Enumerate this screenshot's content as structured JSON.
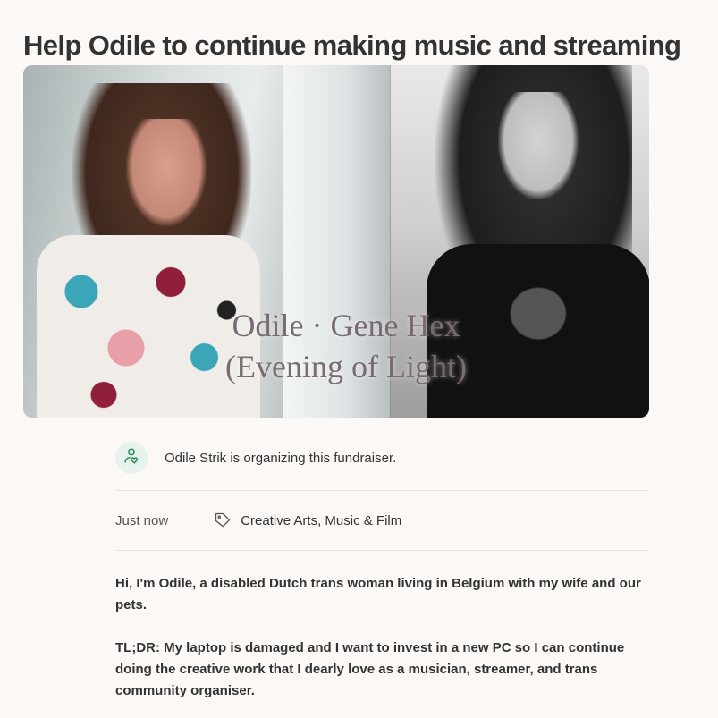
{
  "title": "Help Odile to continue making music and streaming",
  "hero": {
    "caption_line1": "Odile · Gene Hex",
    "caption_line2": "(Evening of Light)"
  },
  "organizer": {
    "icon": "user-heart-icon",
    "text": "Odile Strik is organizing this fundraiser."
  },
  "meta": {
    "posted": "Just now",
    "category_icon": "tag-icon",
    "category": "Creative Arts, Music & Film"
  },
  "story": {
    "paragraphs": [
      "Hi, I'm Odile, a disabled Dutch trans woman living in Belgium with my wife and our pets.",
      "TL;DR: My laptop is damaged and I want to invest in a new PC so I can continue doing the creative work that I dearly love as a musician, streamer, and trans community organiser."
    ]
  },
  "colors": {
    "background": "#fbf8f6",
    "accent_green": "#2a8c5a",
    "avatar_bg": "#e6f3ec"
  }
}
